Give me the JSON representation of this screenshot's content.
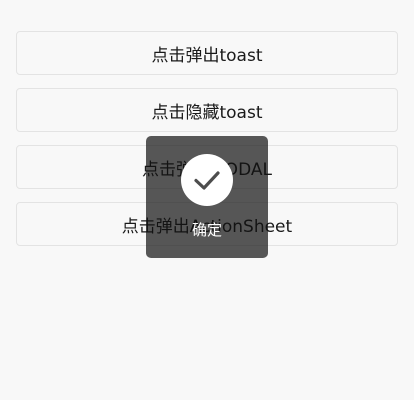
{
  "buttons": [
    {
      "label": "点击弹出toast"
    },
    {
      "label": "点击隐藏toast"
    },
    {
      "label": "点击弹出MODAL"
    },
    {
      "label": "点击弹出ActionSheet"
    }
  ],
  "toast": {
    "icon": "checkmark-icon",
    "text": "确定",
    "background_color": "#4d4d4d",
    "icon_color": "#4d4d4d"
  }
}
